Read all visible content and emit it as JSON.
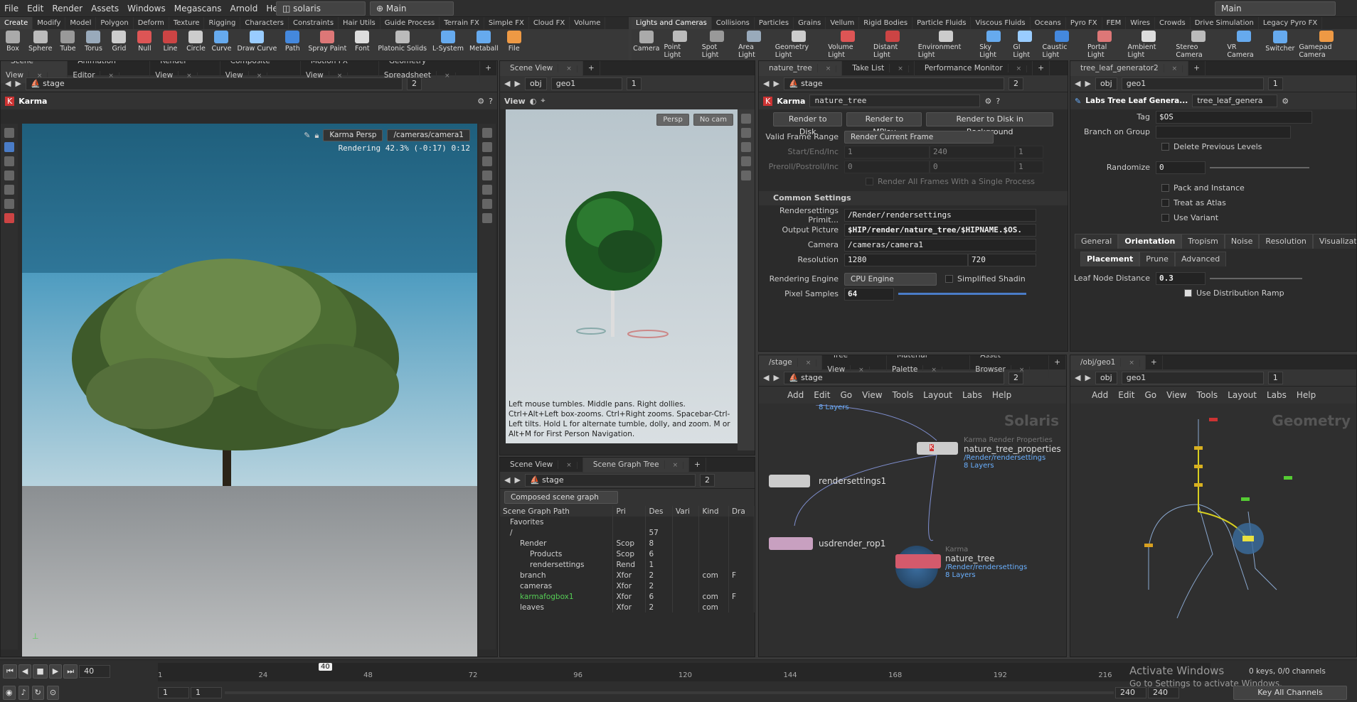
{
  "menubar": {
    "items": [
      "File",
      "Edit",
      "Render",
      "Assets",
      "Windows",
      "Megascans",
      "Arnold",
      "Help"
    ],
    "context": "solaris",
    "desktop": "Main",
    "desktop_right": "Main"
  },
  "shelf_tabs_left": [
    "Create",
    "Modify",
    "Model",
    "Polygon",
    "Deform",
    "Texture",
    "Rigging",
    "Characters",
    "Constraints",
    "Hair Utils",
    "Guide Process",
    "Terrain FX",
    "Simple FX",
    "Cloud FX",
    "Volume"
  ],
  "shelf_tabs_right": [
    "Lights and Cameras",
    "Collisions",
    "Particles",
    "Grains",
    "Vellum",
    "Rigid Bodies",
    "Particle Fluids",
    "Viscous Fluids",
    "Oceans",
    "Pyro FX",
    "FEM",
    "Wires",
    "Crowds",
    "Drive Simulation",
    "Legacy Pyro FX"
  ],
  "tools_left": [
    "Box",
    "Sphere",
    "Tube",
    "Torus",
    "Grid",
    "Null",
    "Line",
    "Circle",
    "Curve",
    "Draw Curve",
    "Path",
    "Spray Paint",
    "Font",
    "Platonic Solids",
    "L-System",
    "Metaball",
    "File"
  ],
  "tools_right": [
    "Camera",
    "Point Light",
    "Spot Light",
    "Area Light",
    "Geometry Light",
    "Volume Light",
    "Distant Light",
    "Environment Light",
    "Sky Light",
    "GI Light",
    "Caustic Light",
    "Portal Light",
    "Ambient Light",
    "Stereo Camera",
    "VR Camera",
    "Switcher",
    "Gamepad Camera"
  ],
  "pane1": {
    "tabs": [
      "Scene View",
      "Animation Editor",
      "Render View",
      "Composite View",
      "Motion FX View",
      "Geometry Spreadsheet"
    ],
    "path": "stage",
    "num": "2",
    "title": "Karma",
    "cam_menu": "Karma Persp",
    "cam_path": "/cameras/camera1",
    "status": "Rendering  42.3%  (-0:17)  0:12"
  },
  "pane2": {
    "tabs": [
      "Scene View"
    ],
    "ctx": "obj",
    "node": "geo1",
    "num": "1",
    "view_label": "View",
    "persp": "Persp",
    "nocam": "No cam",
    "help": "Left mouse tumbles. Middle pans. Right dollies. Ctrl+Alt+Left box-zooms. Ctrl+Right zooms. Spacebar-Ctrl-Left tilts. Hold L for alternate tumble, dolly, and zoom.    M or Alt+M for First Person Navigation."
  },
  "sgt": {
    "tabs": [
      "Scene View",
      "Scene Graph Tree"
    ],
    "path": "stage",
    "num": "2",
    "mode": "Composed scene graph",
    "columns": [
      "Scene Graph Path",
      "Pri",
      "Des",
      "Vari",
      "Kind",
      "Dra"
    ],
    "rows": [
      [
        "Favorites",
        "",
        "",
        "",
        "",
        ""
      ],
      [
        "/",
        "",
        "57",
        "",
        "",
        ""
      ],
      [
        "Render",
        "Scop",
        "8",
        "",
        "",
        ""
      ],
      [
        "Products",
        "Scop",
        "6",
        "",
        "",
        ""
      ],
      [
        "rendersettings",
        "Rend",
        "1",
        "",
        "",
        ""
      ],
      [
        "branch",
        "Xfor",
        "2",
        "",
        "com",
        "F"
      ],
      [
        "cameras",
        "Xfor",
        "2",
        "",
        "",
        ""
      ],
      [
        "karmafogbox1",
        "Xfor",
        "6",
        "",
        "com",
        "F"
      ],
      [
        "leaves",
        "Xfor",
        "2",
        "",
        "com",
        ""
      ]
    ]
  },
  "params": {
    "tabs": [
      "nature_tree",
      "Take List",
      "Performance Monitor"
    ],
    "path": "stage",
    "num": "2",
    "node_type": "Karma",
    "node_name": "nature_tree",
    "buttons": [
      "Render to Disk",
      "Render to MPlay",
      "Render to Disk in Background"
    ],
    "valid_frame_label": "Valid Frame Range",
    "valid_frame": "Render Current Frame",
    "start_label": "Start/End/Inc",
    "start": [
      "1",
      "240",
      "1"
    ],
    "preroll_label": "Preroll/Postroll/Inc",
    "preroll": [
      "0",
      "0",
      "1"
    ],
    "single_proc": "Render All Frames With a Single Process",
    "section": "Common Settings",
    "rs_label": "Rendersettings Primit...",
    "rs": "/Render/rendersettings",
    "out_label": "Output Picture",
    "out": "$HIP/render/nature_tree/$HIPNAME.$OS.",
    "cam_label": "Camera",
    "cam": "/cameras/camera1",
    "res_label": "Resolution",
    "res": [
      "1280",
      "720"
    ],
    "eng_label": "Rendering Engine",
    "eng": "CPU Engine",
    "simp": "Simplified Shadin",
    "ps_label": "Pixel Samples",
    "ps": "64"
  },
  "leaf": {
    "tabs": [
      "tree_leaf_generator2"
    ],
    "ctx": "obj",
    "node": "geo1",
    "num": "1",
    "node_type": "Labs Tree Leaf Genera...",
    "node_name": "tree_leaf_genera",
    "tag_label": "Tag",
    "tag": "$OS",
    "branch_label": "Branch on Group",
    "del": "Delete Previous Levels",
    "rand_label": "Randomize",
    "rand": "0",
    "pack": "Pack and Instance",
    "atlas": "Treat as Atlas",
    "variant": "Use Variant",
    "tabs2": [
      "General",
      "Orientation",
      "Tropism",
      "Noise",
      "Resolution",
      "Visualization"
    ],
    "tabs3": [
      "Placement",
      "Prune",
      "Advanced"
    ],
    "leaf_label": "Leaf Node Distance",
    "leaf_val": "0.3",
    "dist": "Use Distribution Ramp"
  },
  "net1": {
    "tabs": [
      "/stage",
      "Tree View",
      "Material Palette",
      "Asset Browser"
    ],
    "path": "stage",
    "num": "2",
    "menu": [
      "Add",
      "Edit",
      "Go",
      "View",
      "Tools",
      "Layout",
      "Labs",
      "Help"
    ],
    "watermark": "Solaris",
    "top_layers": "8 Layers",
    "n1": {
      "name": "nature_tree_properties",
      "type": "Karma Render Properties",
      "sub1": "/Render/rendersettings",
      "sub2": "8 Layers"
    },
    "n2": {
      "name": "rendersettings1"
    },
    "n3": {
      "name": "usdrender_rop1"
    },
    "n4": {
      "name": "nature_tree",
      "type": "Karma",
      "sub1": "/Render/rendersettings",
      "sub2": "8 Layers"
    }
  },
  "net2": {
    "tabs": [
      "/obj/geo1"
    ],
    "ctx": "obj",
    "node": "geo1",
    "num": "1",
    "menu": [
      "Add",
      "Edit",
      "Go",
      "View",
      "Tools",
      "Layout",
      "Labs",
      "Help"
    ],
    "watermark": "Geometry"
  },
  "timeline": {
    "frame": "40",
    "marker": "40",
    "ticks": [
      "1",
      "24",
      "48",
      "72",
      "96",
      "120",
      "144",
      "168",
      "192",
      "216"
    ],
    "start": "1",
    "start2": "1",
    "end": "240",
    "end2": "240",
    "keys": "0 keys, 0/0 channels",
    "keyall": "Key All Channels",
    "activate1": "Activate Windows",
    "activate2": "Go to Settings to activate Windows."
  },
  "colors": {
    "accent": "#f7a020",
    "sky": "#3f8bb0",
    "node_blue": "#6ab0ff"
  }
}
